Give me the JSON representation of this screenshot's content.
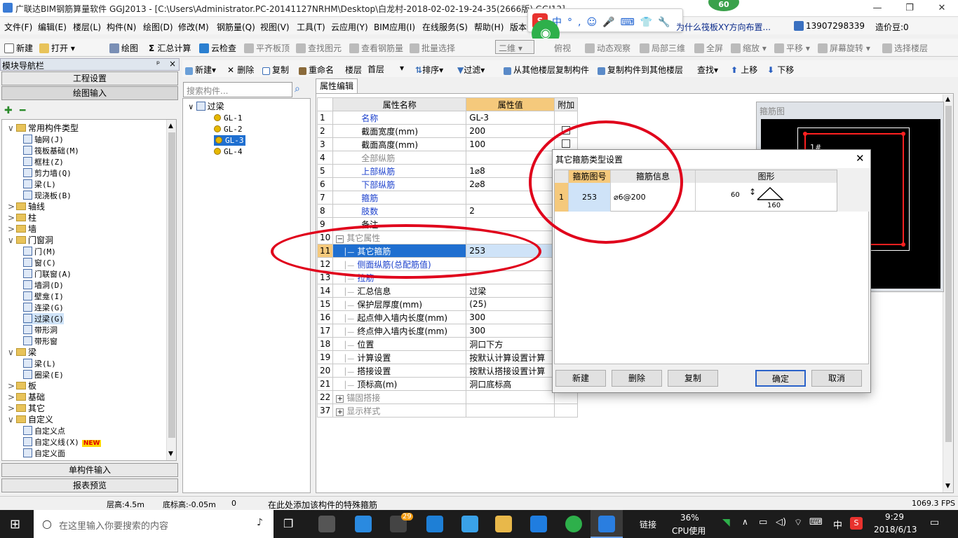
{
  "window": {
    "title": "广联达BIM钢筋算量软件 GGJ2013 - [C:\\Users\\Administrator.PC-20141127NRHM\\Desktop\\白龙村-2018-02-02-19-24-35(2666版).GGJ12]",
    "badge": "60"
  },
  "menu": [
    "文件(F)",
    "编辑(E)",
    "楼层(L)",
    "构件(N)",
    "绘图(D)",
    "修改(M)",
    "钢筋量(Q)",
    "视图(V)",
    "工具(T)",
    "云应用(Y)",
    "BIM应用(I)",
    "在线服务(S)",
    "帮助(H)",
    "版本号(B)"
  ],
  "menu_right": {
    "link": "为什么筏板XY方向布置...",
    "phone": "13907298339",
    "price": "造价豆:0"
  },
  "ime": {
    "items": [
      "中",
      "°,",
      "☺",
      "🎤",
      "⌨",
      "👕",
      "🔧"
    ]
  },
  "toolbar": {
    "new": "新建",
    "open": "打开",
    "draw": "绘图",
    "sum": "汇总计算",
    "cloudcheck": "云检查",
    "flatten": "平齐板顶",
    "findelem": "查找图元",
    "viewrebar": "查看钢筋量",
    "batchsel": "批量选择",
    "view2d": "二维",
    "view3": "俯视",
    "dynobs": "动态观察",
    "local3d": "局部三维",
    "fullscreen": "全屏",
    "zoom": "缩放",
    "pan": "平移",
    "rotate": "屏幕旋转",
    "selfloor": "选择楼层"
  },
  "nav": {
    "title": "模块导航栏",
    "project_settings": "工程设置",
    "draw_input": "绘图输入",
    "single_input": "单构件输入",
    "report_preview": "报表预览",
    "tree": [
      {
        "label": "常用构件类型",
        "level": 0,
        "type": "folder",
        "toggle": "∨"
      },
      {
        "label": "轴网(J)",
        "level": 1,
        "type": "comp"
      },
      {
        "label": "筏板基础(M)",
        "level": 1,
        "type": "comp"
      },
      {
        "label": "框柱(Z)",
        "level": 1,
        "type": "comp"
      },
      {
        "label": "剪力墙(Q)",
        "level": 1,
        "type": "comp"
      },
      {
        "label": "梁(L)",
        "level": 1,
        "type": "comp"
      },
      {
        "label": "现浇板(B)",
        "level": 1,
        "type": "comp"
      },
      {
        "label": "轴线",
        "level": 0,
        "type": "folder",
        "toggle": ">"
      },
      {
        "label": "柱",
        "level": 0,
        "type": "folder",
        "toggle": ">"
      },
      {
        "label": "墙",
        "level": 0,
        "type": "folder",
        "toggle": ">"
      },
      {
        "label": "门窗洞",
        "level": 0,
        "type": "folder",
        "toggle": "∨"
      },
      {
        "label": "门(M)",
        "level": 1,
        "type": "comp"
      },
      {
        "label": "窗(C)",
        "level": 1,
        "type": "comp"
      },
      {
        "label": "门联窗(A)",
        "level": 1,
        "type": "comp"
      },
      {
        "label": "墙洞(D)",
        "level": 1,
        "type": "comp"
      },
      {
        "label": "壁龛(I)",
        "level": 1,
        "type": "comp"
      },
      {
        "label": "连梁(G)",
        "level": 1,
        "type": "comp"
      },
      {
        "label": "过梁(G)",
        "level": 1,
        "type": "comp",
        "selected": true
      },
      {
        "label": "带形洞",
        "level": 1,
        "type": "comp"
      },
      {
        "label": "带形窗",
        "level": 1,
        "type": "comp"
      },
      {
        "label": "梁",
        "level": 0,
        "type": "folder",
        "toggle": "∨"
      },
      {
        "label": "梁(L)",
        "level": 1,
        "type": "comp"
      },
      {
        "label": "圈梁(E)",
        "level": 1,
        "type": "comp"
      },
      {
        "label": "板",
        "level": 0,
        "type": "folder",
        "toggle": ">"
      },
      {
        "label": "基础",
        "level": 0,
        "type": "folder",
        "toggle": ">"
      },
      {
        "label": "其它",
        "level": 0,
        "type": "folder",
        "toggle": ">"
      },
      {
        "label": "自定义",
        "level": 0,
        "type": "folder",
        "toggle": "∨"
      },
      {
        "label": "自定义点",
        "level": 1,
        "type": "comp"
      },
      {
        "label": "自定义线(X)",
        "level": 1,
        "type": "comp",
        "new": "NEW"
      },
      {
        "label": "自定义面",
        "level": 1,
        "type": "comp"
      }
    ]
  },
  "midtoolbar": {
    "new": "新建",
    "delete": "删除",
    "copy": "复制",
    "rename": "重命名",
    "floor_label": "楼层",
    "floor_value": "首层",
    "sort": "排序",
    "filter": "过滤",
    "copyfrom": "从其他楼层复制构件",
    "copyto": "复制构件到其他楼层",
    "find": "查找",
    "moveup": "上移",
    "movedown": "下移"
  },
  "search": {
    "placeholder": "搜索构件..."
  },
  "comptree": {
    "root": "过梁",
    "items": [
      "GL-1",
      "GL-2",
      "GL-3",
      "GL-4"
    ],
    "selected": "GL-3"
  },
  "props": {
    "tab": "属性编辑",
    "headers": {
      "name": "属性名称",
      "value": "属性值",
      "extra": "附加"
    },
    "rows": [
      {
        "n": "1",
        "name": "名称",
        "value": "GL-3",
        "style": "blue",
        "indent": 0
      },
      {
        "n": "2",
        "name": "截面宽度(mm)",
        "value": "200",
        "style": "",
        "indent": 0,
        "chk": true
      },
      {
        "n": "3",
        "name": "截面高度(mm)",
        "value": "100",
        "style": "",
        "indent": 0,
        "chk": true
      },
      {
        "n": "4",
        "name": "全部纵筋",
        "value": "",
        "style": "gray",
        "indent": 0
      },
      {
        "n": "5",
        "name": "上部纵筋",
        "value": "1⌀8",
        "style": "blue",
        "indent": 0
      },
      {
        "n": "6",
        "name": "下部纵筋",
        "value": "2⌀8",
        "style": "blue",
        "indent": 0
      },
      {
        "n": "7",
        "name": "箍筋",
        "value": "",
        "style": "blue",
        "indent": 0
      },
      {
        "n": "8",
        "name": "肢数",
        "value": "2",
        "style": "blue",
        "indent": 0
      },
      {
        "n": "9",
        "name": "备注",
        "value": "",
        "style": "",
        "indent": 0
      },
      {
        "n": "10",
        "name": "其它属性",
        "value": "",
        "style": "gray",
        "indent": 0,
        "group": "−"
      },
      {
        "n": "11",
        "name": "其它箍筋",
        "value": "253",
        "style": "",
        "indent": 1,
        "selected": true
      },
      {
        "n": "12",
        "name": "侧面纵筋(总配筋值)",
        "value": "",
        "style": "blue",
        "indent": 1
      },
      {
        "n": "13",
        "name": "拉筋",
        "value": "",
        "style": "blue",
        "indent": 1
      },
      {
        "n": "14",
        "name": "汇总信息",
        "value": "过梁",
        "style": "",
        "indent": 1
      },
      {
        "n": "15",
        "name": "保护层厚度(mm)",
        "value": "(25)",
        "style": "",
        "indent": 1
      },
      {
        "n": "16",
        "name": "起点伸入墙内长度(mm)",
        "value": "300",
        "style": "",
        "indent": 1
      },
      {
        "n": "17",
        "name": "终点伸入墙内长度(mm)",
        "value": "300",
        "style": "",
        "indent": 1
      },
      {
        "n": "18",
        "name": "位置",
        "value": "洞口下方",
        "style": "",
        "indent": 1
      },
      {
        "n": "19",
        "name": "计算设置",
        "value": "按默认计算设置计算",
        "style": "",
        "indent": 1
      },
      {
        "n": "20",
        "name": "搭接设置",
        "value": "按默认搭接设置计算",
        "style": "",
        "indent": 1
      },
      {
        "n": "21",
        "name": "顶标高(m)",
        "value": "洞口底标高",
        "style": "",
        "indent": 1
      },
      {
        "n": "22",
        "name": "锚固搭接",
        "value": "",
        "style": "gray",
        "indent": 0,
        "group": "+"
      },
      {
        "n": "37",
        "name": "显示样式",
        "value": "",
        "style": "gray",
        "indent": 0,
        "group": "+"
      }
    ]
  },
  "preview": {
    "title": "箍筋图",
    "label": "1#"
  },
  "dialog": {
    "title": "其它箍筋类型设置",
    "headers": {
      "code": "箍筋图号",
      "info": "箍筋信息",
      "shape": "图形"
    },
    "row": {
      "n": "1",
      "code": "253",
      "info": "⌀6@200",
      "h": "60",
      "w": "160"
    },
    "buttons": {
      "new": "新建",
      "delete": "删除",
      "copy": "复制",
      "ok": "确定",
      "cancel": "取消"
    }
  },
  "status": {
    "floor_height": "层高:4.5m",
    "base_elev": "底标高:-0.05m",
    "count": "0",
    "hint": "在此处添加该构件的特殊箍筋",
    "fps": "1069.3 FPS"
  },
  "taskbar": {
    "search_placeholder": "在这里输入你要搜索的内容",
    "link": "链接",
    "cpu_percent": "36%",
    "cpu_label": "CPU使用",
    "lang": "中",
    "time": "9:29",
    "date": "2018/6/13",
    "wechat_badge": "29"
  }
}
